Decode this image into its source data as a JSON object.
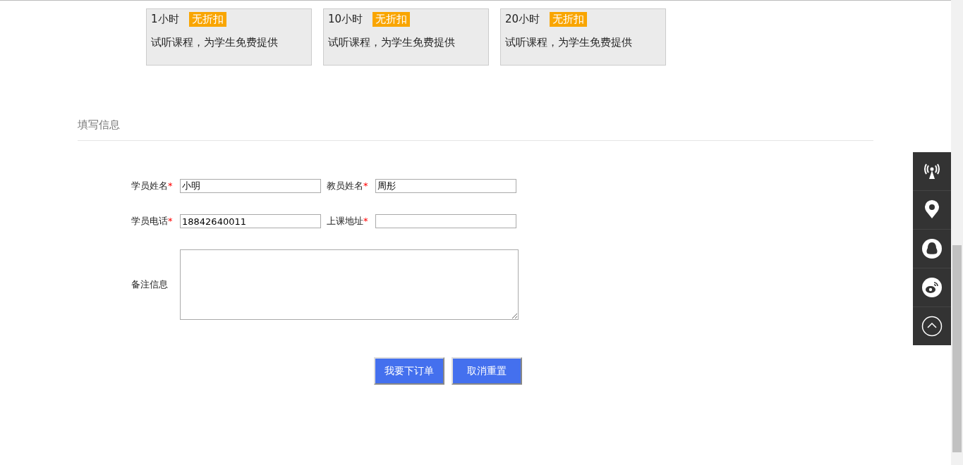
{
  "packages": [
    {
      "hours": "1小时",
      "badge": "无折扣",
      "description": "试听课程，为学生免费提供"
    },
    {
      "hours": "10小时",
      "badge": "无折扣",
      "description": "试听课程，为学生免费提供"
    },
    {
      "hours": "20小时",
      "badge": "无折扣",
      "description": "试听课程，为学生免费提供"
    }
  ],
  "section_title": "填写信息",
  "form_rows": [
    [
      {
        "kind": "text",
        "label": "学员姓名",
        "required": true,
        "value": "小明"
      },
      {
        "kind": "text",
        "label": "教员姓名",
        "required": true,
        "value": "周彤"
      }
    ],
    [
      {
        "kind": "text",
        "label": "学员电话",
        "required": true,
        "value": "18842640011"
      },
      {
        "kind": "text",
        "label": "上课地址",
        "required": true
      }
    ],
    [
      {
        "kind": "textarea",
        "label": "备注信息",
        "required": false
      }
    ]
  ],
  "required_mark": "*",
  "buttons": [
    "我要下订单",
    "取消重置"
  ]
}
